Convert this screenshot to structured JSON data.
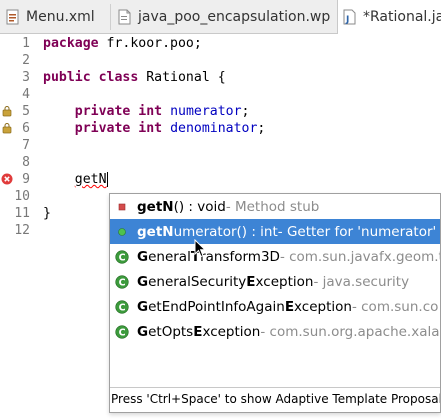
{
  "tabs": [
    {
      "label": "Menu.xml",
      "icon": "xml-file-icon",
      "active": false
    },
    {
      "label": "java_poo_encapsulation.wp",
      "icon": "document-icon",
      "active": false
    },
    {
      "label": "*Rational.java",
      "icon": "java-file-icon",
      "active": true
    }
  ],
  "editor": {
    "lines": [
      {
        "num": "1",
        "text": "package fr.koor.poo;"
      },
      {
        "num": "2",
        "text": ""
      },
      {
        "num": "3",
        "text": "public class Rational {"
      },
      {
        "num": "4",
        "text": ""
      },
      {
        "num": "5",
        "text": "    private int numerator;"
      },
      {
        "num": "6",
        "text": "    private int denominator;"
      },
      {
        "num": "7",
        "text": ""
      },
      {
        "num": "8",
        "text": ""
      },
      {
        "num": "9",
        "text": "    getN"
      },
      {
        "num": "10",
        "text": ""
      },
      {
        "num": "11",
        "text": "}"
      },
      {
        "num": "12",
        "text": ""
      }
    ],
    "tokens": {
      "package_kw": "package",
      "package_name": " fr.koor.poo;",
      "public_kw": "public",
      "class_kw": "class",
      "class_name": " Rational {",
      "private_kw": "private",
      "int_kw": "int",
      "field1": "numerator",
      "field2": "denominator",
      "semicolon": ";",
      "typed": "getN",
      "closing_brace": "}"
    }
  },
  "completion": {
    "items": [
      {
        "bold": "getN",
        "rest": "() : void",
        "qualifier": " - Method stub",
        "icon": "method-stub-icon",
        "selected": false
      },
      {
        "bold": "getN",
        "rest": "umerator() : int",
        "qualifier": " - Getter for 'numerator'",
        "icon": "getter-icon",
        "selected": true
      },
      {
        "bold_parts": [
          "G",
          "eneral",
          "T",
          "ransform3D"
        ],
        "qualifier": " - com.sun.javafx.geom.tr",
        "icon": "class-icon",
        "selected": false
      },
      {
        "bold_parts": [
          "G",
          "eneralSecurity",
          "E",
          "xception"
        ],
        "qualifier": " - java.security",
        "icon": "class-icon",
        "selected": false
      },
      {
        "bold_parts": [
          "G",
          "etEndPointInfoAgain",
          "E",
          "xception"
        ],
        "qualifier": " - com.sun.co",
        "icon": "class-icon",
        "selected": false
      },
      {
        "bold_parts": [
          "G",
          "etOpts",
          "E",
          "xception"
        ],
        "qualifier": " - com.sun.org.apache.xalan",
        "icon": "class-icon",
        "selected": false
      }
    ],
    "footer": "Press 'Ctrl+Space' to show Adaptive Template Proposals (C",
    "colors": {
      "selection": "#3d84d5",
      "qualifier": "#8c8c8c"
    }
  },
  "colors": {
    "keyword": "#7f0055",
    "field": "#0000c0",
    "line_number": "#787878",
    "error": "#e03b3b"
  }
}
